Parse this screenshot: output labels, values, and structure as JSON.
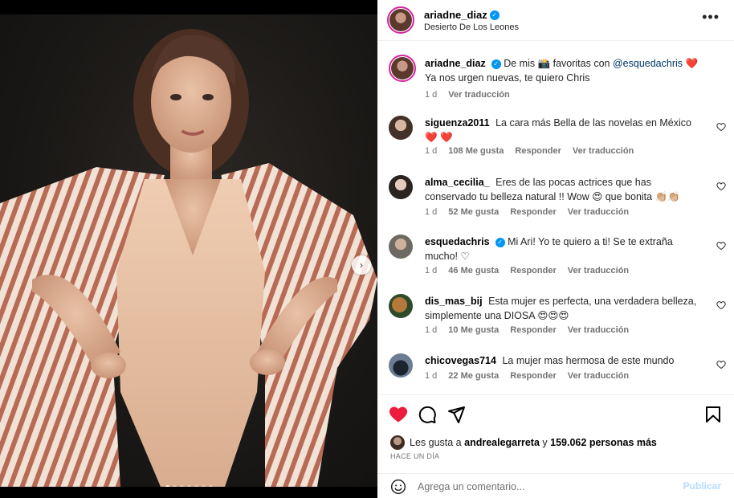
{
  "post": {
    "author": "ariadne_diaz",
    "location": "Desierto De Los Leones",
    "verified": true,
    "carousel": {
      "count": 7,
      "active_index": 0
    }
  },
  "caption": {
    "username": "ariadne_diaz",
    "text_part1": "De mis 📸 favoritas con",
    "mention": "@esquedachris",
    "heart": "❤️",
    "line2": "Ya nos urgen nuevas, te quiero Chris",
    "age": "1 d",
    "translate": "Ver traducción"
  },
  "comments": [
    {
      "username": "siguenza2011",
      "text": "La cara más Bella de las novelas en México ❤️ ❤️",
      "age": "1 d",
      "likes": "108 Me gusta",
      "reply": "Responder",
      "translate": "Ver traducción"
    },
    {
      "username": "alma_cecilia_",
      "text": "Eres de las pocas actrices que has conservado tu belleza natural !! Wow 😍 que bonita 👏🏼👏🏼",
      "age": "1 d",
      "likes": "52 Me gusta",
      "reply": "Responder",
      "translate": "Ver traducción"
    },
    {
      "username": "esquedachris",
      "verified": true,
      "text": "Mi Ari! Yo te quiero a ti! Se te extraña mucho! ♡",
      "age": "1 d",
      "likes": "46 Me gusta",
      "reply": "Responder",
      "translate": "Ver traducción"
    },
    {
      "username": "dis_mas_bij",
      "text": "Esta mujer es perfecta, una verdadera belleza, simplemente una DIOSA 😍😍😍",
      "age": "1 d",
      "likes": "10 Me gusta",
      "reply": "Responder",
      "translate": "Ver traducción"
    },
    {
      "username": "chicovegas714",
      "text": "La mujer mas hermosa de este mundo",
      "age": "1 d",
      "likes": "22 Me gusta",
      "reply": "Responder",
      "translate": "Ver traducción"
    }
  ],
  "likes": {
    "prefix": "Les gusta a",
    "user": "andrealegarreta",
    "middle": "y",
    "count": "159.062 personas más"
  },
  "timestamp": "HACE UN DÍA",
  "add_comment": {
    "placeholder": "Agrega un comentario...",
    "publish": "Publicar"
  },
  "icons": {
    "like": "heart-filled-icon",
    "comment": "comment-icon",
    "share": "send-icon",
    "save": "bookmark-icon",
    "more": "more-options-icon",
    "emoji": "emoji-icon",
    "next": "chevron-right-icon"
  },
  "colors": {
    "like_red": "#ed1c3c",
    "verified_blue": "#0095f6",
    "link_blue": "#00376b",
    "publish_disabled": "#b3dbff"
  }
}
